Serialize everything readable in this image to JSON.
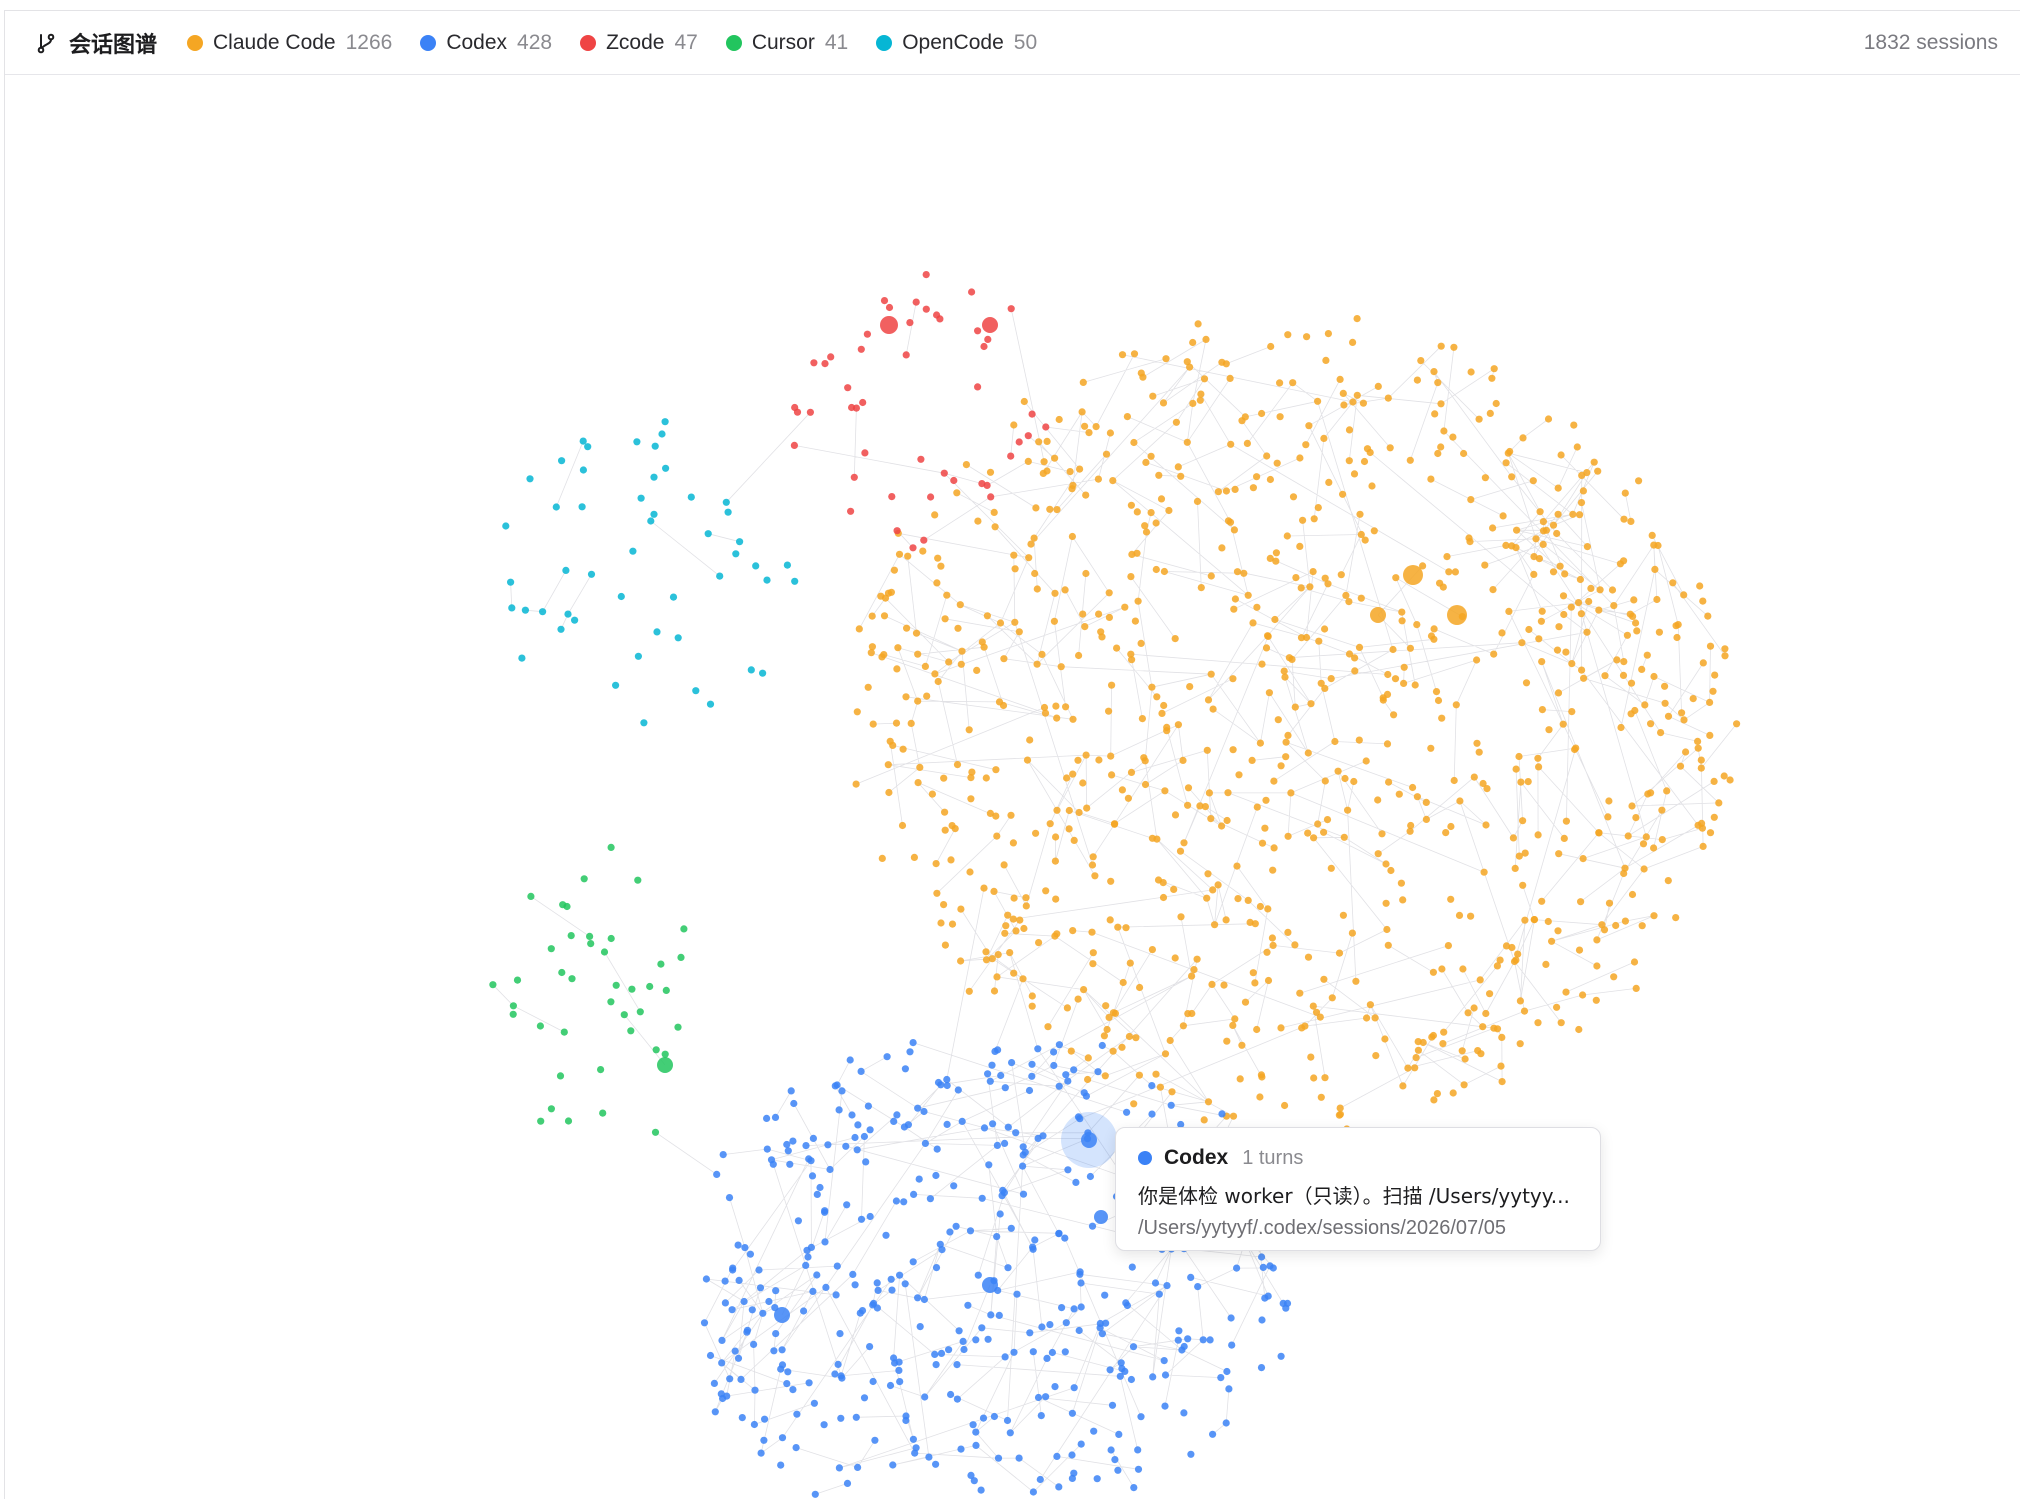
{
  "header": {
    "title": "会话图谱",
    "icon": "branch-icon",
    "session_count": "1832 sessions"
  },
  "legend": [
    {
      "label": "Claude Code",
      "count": "1266",
      "color": "#f5a623"
    },
    {
      "label": "Codex",
      "count": "428",
      "color": "#3b82f6"
    },
    {
      "label": "Zcode",
      "count": "47",
      "color": "#ef4444"
    },
    {
      "label": "Cursor",
      "count": "41",
      "color": "#22c55e"
    },
    {
      "label": "OpenCode",
      "count": "50",
      "color": "#06b6d4"
    }
  ],
  "tooltip": {
    "source": "Codex",
    "turns": "1 turns",
    "text": "你是体检 worker（只读）。扫描 /Users/yytyy...",
    "path": "/Users/yytyyf/.codex/sessions/2026/07/05",
    "color": "#3b82f6"
  }
}
